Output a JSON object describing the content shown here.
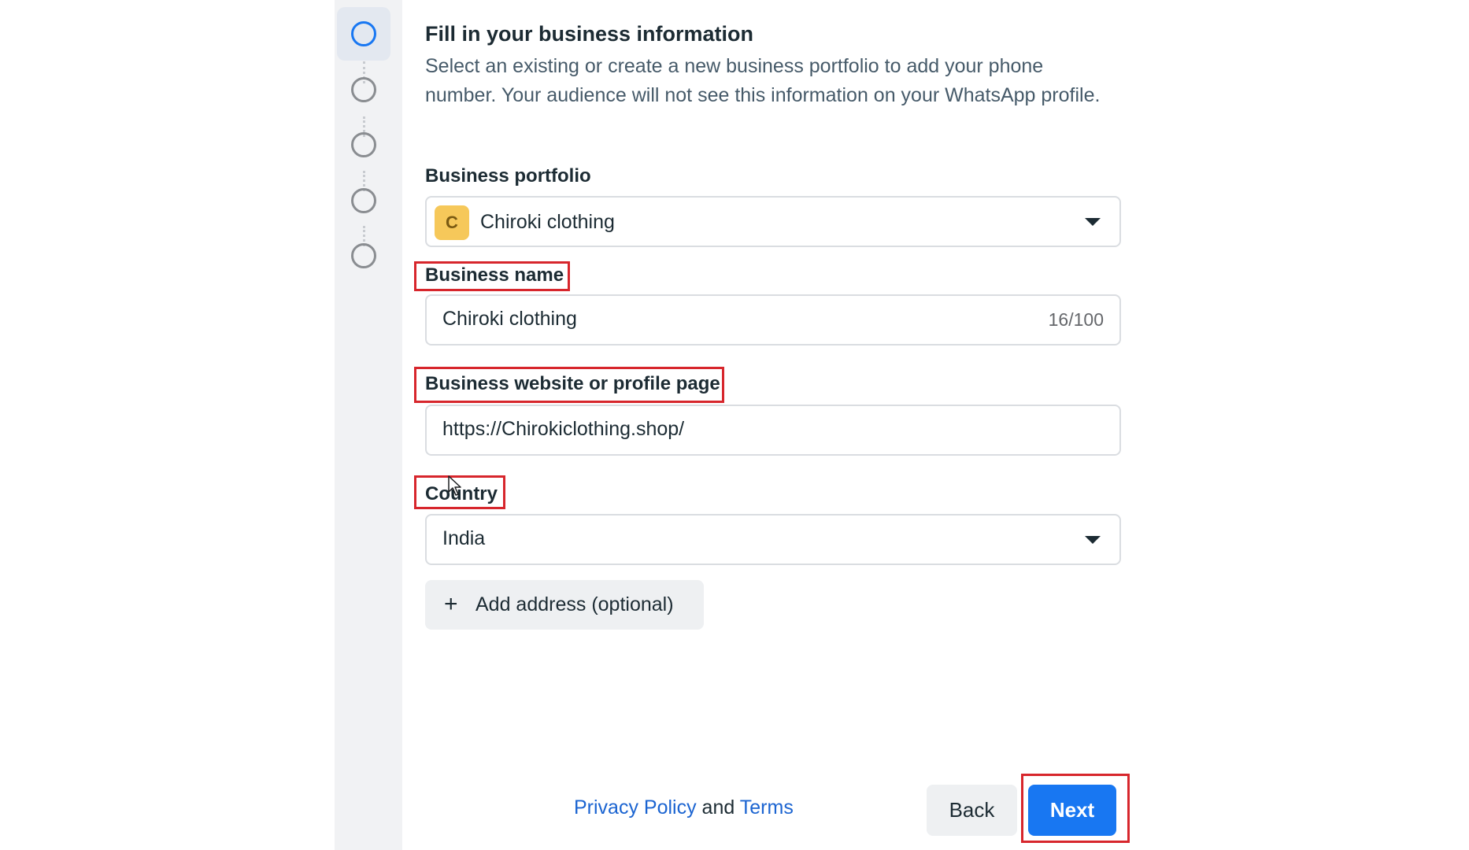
{
  "stepper": {
    "steps": [
      "step-1",
      "step-2",
      "step-3",
      "step-4",
      "step-5"
    ],
    "active_step": 1,
    "active_color": "#1877f2"
  },
  "header": {
    "title": "Fill in your business information",
    "description": "Select an existing or create a new business portfolio to add your phone number. Your audience will not see this information on your WhatsApp profile."
  },
  "business_portfolio": {
    "label": "Business portfolio",
    "avatar_letter": "C",
    "selected": "Chiroki clothing"
  },
  "business_name": {
    "label": "Business name",
    "value": "Chiroki clothing",
    "counter": "16/100"
  },
  "business_website": {
    "label": "Business website or profile page",
    "value": "https://Chirokiclothing.shop/"
  },
  "country": {
    "label": "Country",
    "selected": "India"
  },
  "add_address": {
    "label": "Add address (optional)",
    "icon": "plus-icon"
  },
  "footer": {
    "privacy_policy": "Privacy Policy",
    "and": "and",
    "terms": "Terms",
    "back_label": "Back",
    "next_label": "Next"
  },
  "colors": {
    "primary": "#1877f2",
    "highlight": "#d7262c",
    "link": "#1b64d1"
  }
}
